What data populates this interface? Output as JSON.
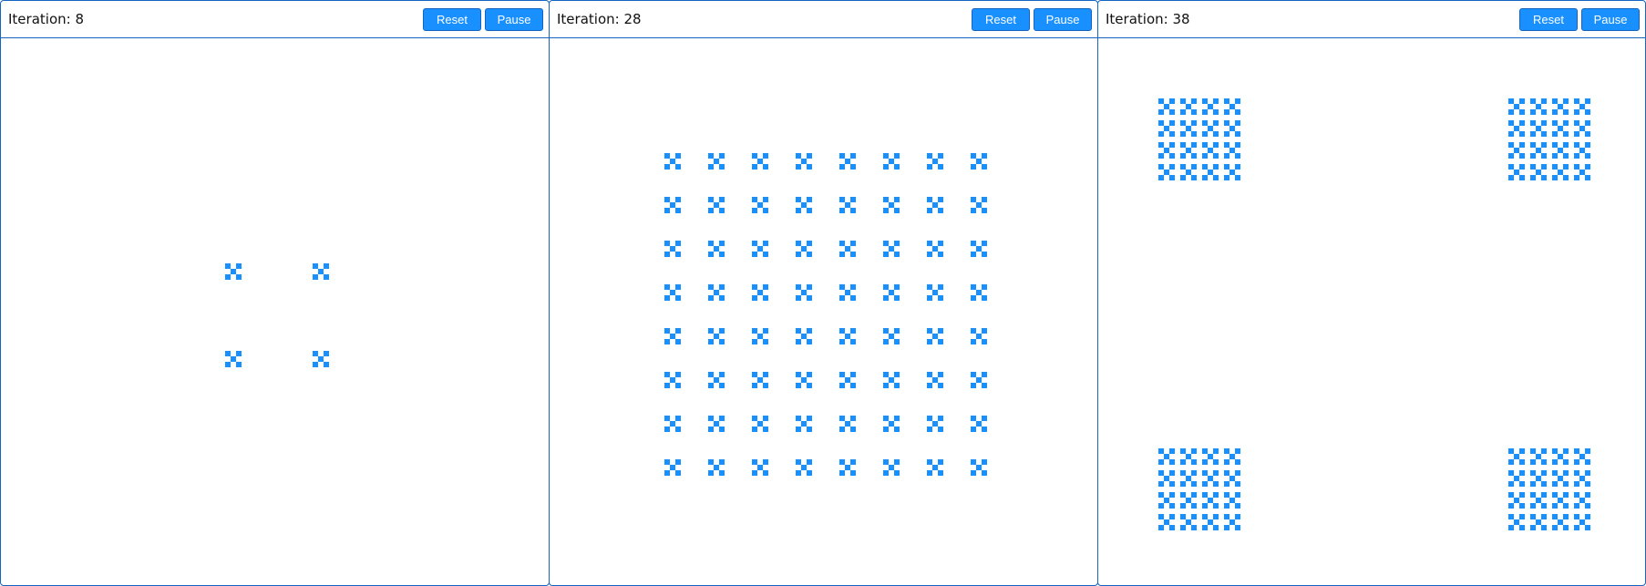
{
  "accent_color": "#1890ff",
  "border_color": "#1565c0",
  "panels": [
    {
      "iteration_label": "Iteration: 8",
      "reset_label": "Reset",
      "pause_label": "Pause"
    },
    {
      "iteration_label": "Iteration: 28",
      "reset_label": "Reset",
      "pause_label": "Pause"
    },
    {
      "iteration_label": "Iteration: 38",
      "reset_label": "Reset",
      "pause_label": "Pause"
    }
  ]
}
